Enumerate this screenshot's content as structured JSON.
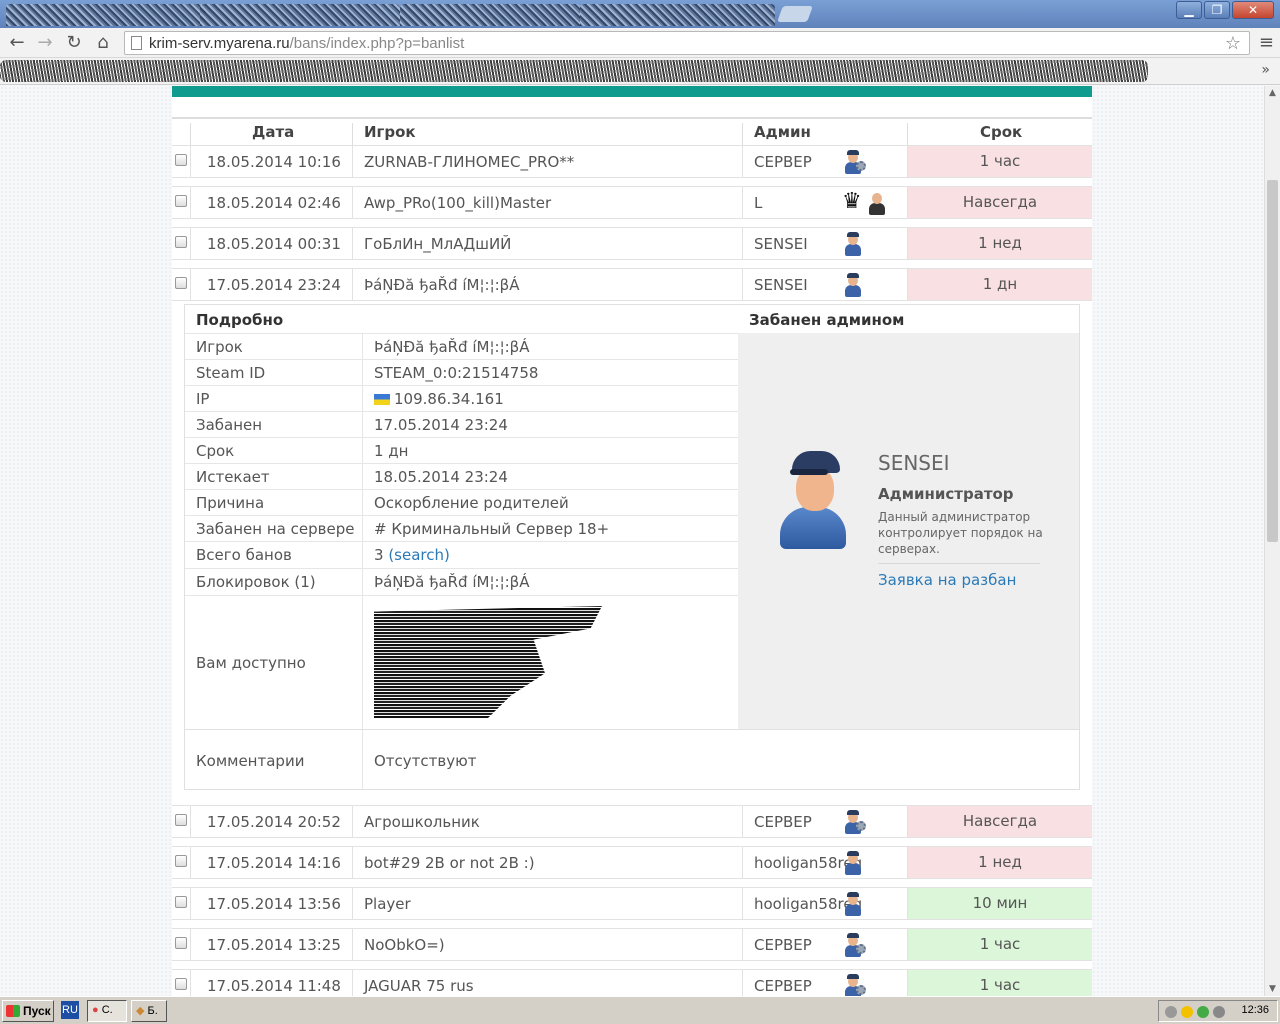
{
  "browser": {
    "url_host": "krim-serv.myarena.ru",
    "url_path": "/bans/index.php?p=banlist",
    "more_label": "»"
  },
  "table": {
    "headers": {
      "date": "Дата",
      "player": "Игрок",
      "admin": "Админ",
      "term": "Срок"
    },
    "rows_top": [
      {
        "date": "18.05.2014 10:16",
        "player": "ZURNAB-ГЛИНОМЕС_PRO**",
        "admin": "СЕРВЕР",
        "icon": "server-admin-icon",
        "term": "1 час",
        "term_color": "red"
      },
      {
        "date": "18.05.2014 02:46",
        "player": "Awp_PRo(100_kill)Master",
        "admin": "L",
        "icon": "crown-admin-icon",
        "term": "Навсегда",
        "term_color": "red"
      },
      {
        "date": "18.05.2014 00:31",
        "player": "ГоБлИн_МлАДшИЙ",
        "admin": "SENSEI",
        "icon": "police-admin-icon",
        "term": "1 нед",
        "term_color": "red"
      },
      {
        "date": "17.05.2014 23:24",
        "player": "ÞáŅĐă ђaŘđ íМ¦:¦:βÁ",
        "admin": "SENSEI",
        "icon": "police-admin-icon",
        "term": "1 дн",
        "term_color": "red"
      }
    ],
    "rows_bottom": [
      {
        "date": "17.05.2014 20:52",
        "player": "Агрошкольник",
        "admin": "СЕРВЕР",
        "icon": "server-admin-icon",
        "term": "Навсегда",
        "term_color": "red"
      },
      {
        "date": "17.05.2014 14:16",
        "player": "bot#29 2B or not 2B :)",
        "admin": "hooligan58reg",
        "icon": "police-admin-icon",
        "term": "1 нед",
        "term_color": "red"
      },
      {
        "date": "17.05.2014 13:56",
        "player": "Player",
        "admin": "hooligan58reg",
        "icon": "police-admin-icon",
        "term": "10 мин",
        "term_color": "green"
      },
      {
        "date": "17.05.2014 13:25",
        "player": "NoObkO=)",
        "admin": "СЕРВЕР",
        "icon": "server-admin-icon",
        "term": "1 час",
        "term_color": "green"
      },
      {
        "date": "17.05.2014 11:48",
        "player": "JAGUAR 75 rus",
        "admin": "СЕРВЕР",
        "icon": "server-admin-icon",
        "term": "1 час",
        "term_color": "green"
      }
    ]
  },
  "details": {
    "header_left": "Подробно",
    "header_right": "Забанен админом",
    "fields": [
      {
        "key": "Игрок",
        "value": "ÞáŅĐă ђaŘđ íМ¦:¦:βÁ"
      },
      {
        "key": "Steam ID",
        "value": "STEAM_0:0:21514758"
      },
      {
        "key": "IP",
        "value": "109.86.34.161"
      },
      {
        "key": "Забанен",
        "value": "17.05.2014 23:24"
      },
      {
        "key": "Срок",
        "value": "1 дн"
      },
      {
        "key": "Истекает",
        "value": "18.05.2014 23:24"
      },
      {
        "key": "Причина",
        "value": "Оскорбление родителей"
      },
      {
        "key": "Забанен на сервере",
        "value": "# Криминальный Сервер 18+"
      },
      {
        "key": "Всего банов",
        "value": "3",
        "link": "(search)"
      },
      {
        "key": "Блокировок (1)",
        "value": "ÞáŅĐă ђaŘđ íМ¦:¦:βÁ"
      }
    ],
    "available_label": "Вам доступно",
    "comments_label": "Комментарии",
    "comments_value": "Отсутствуют",
    "admin": {
      "name": "SENSEI",
      "role": "Администратор",
      "description": "Данный администратор контролирует порядок на серверах.",
      "unban_link": "Заявка на разбан"
    }
  },
  "taskbar": {
    "start_label": "Пуск",
    "lang": "RU",
    "task1": "C.",
    "task2": "Б.",
    "clock": "12:36"
  }
}
